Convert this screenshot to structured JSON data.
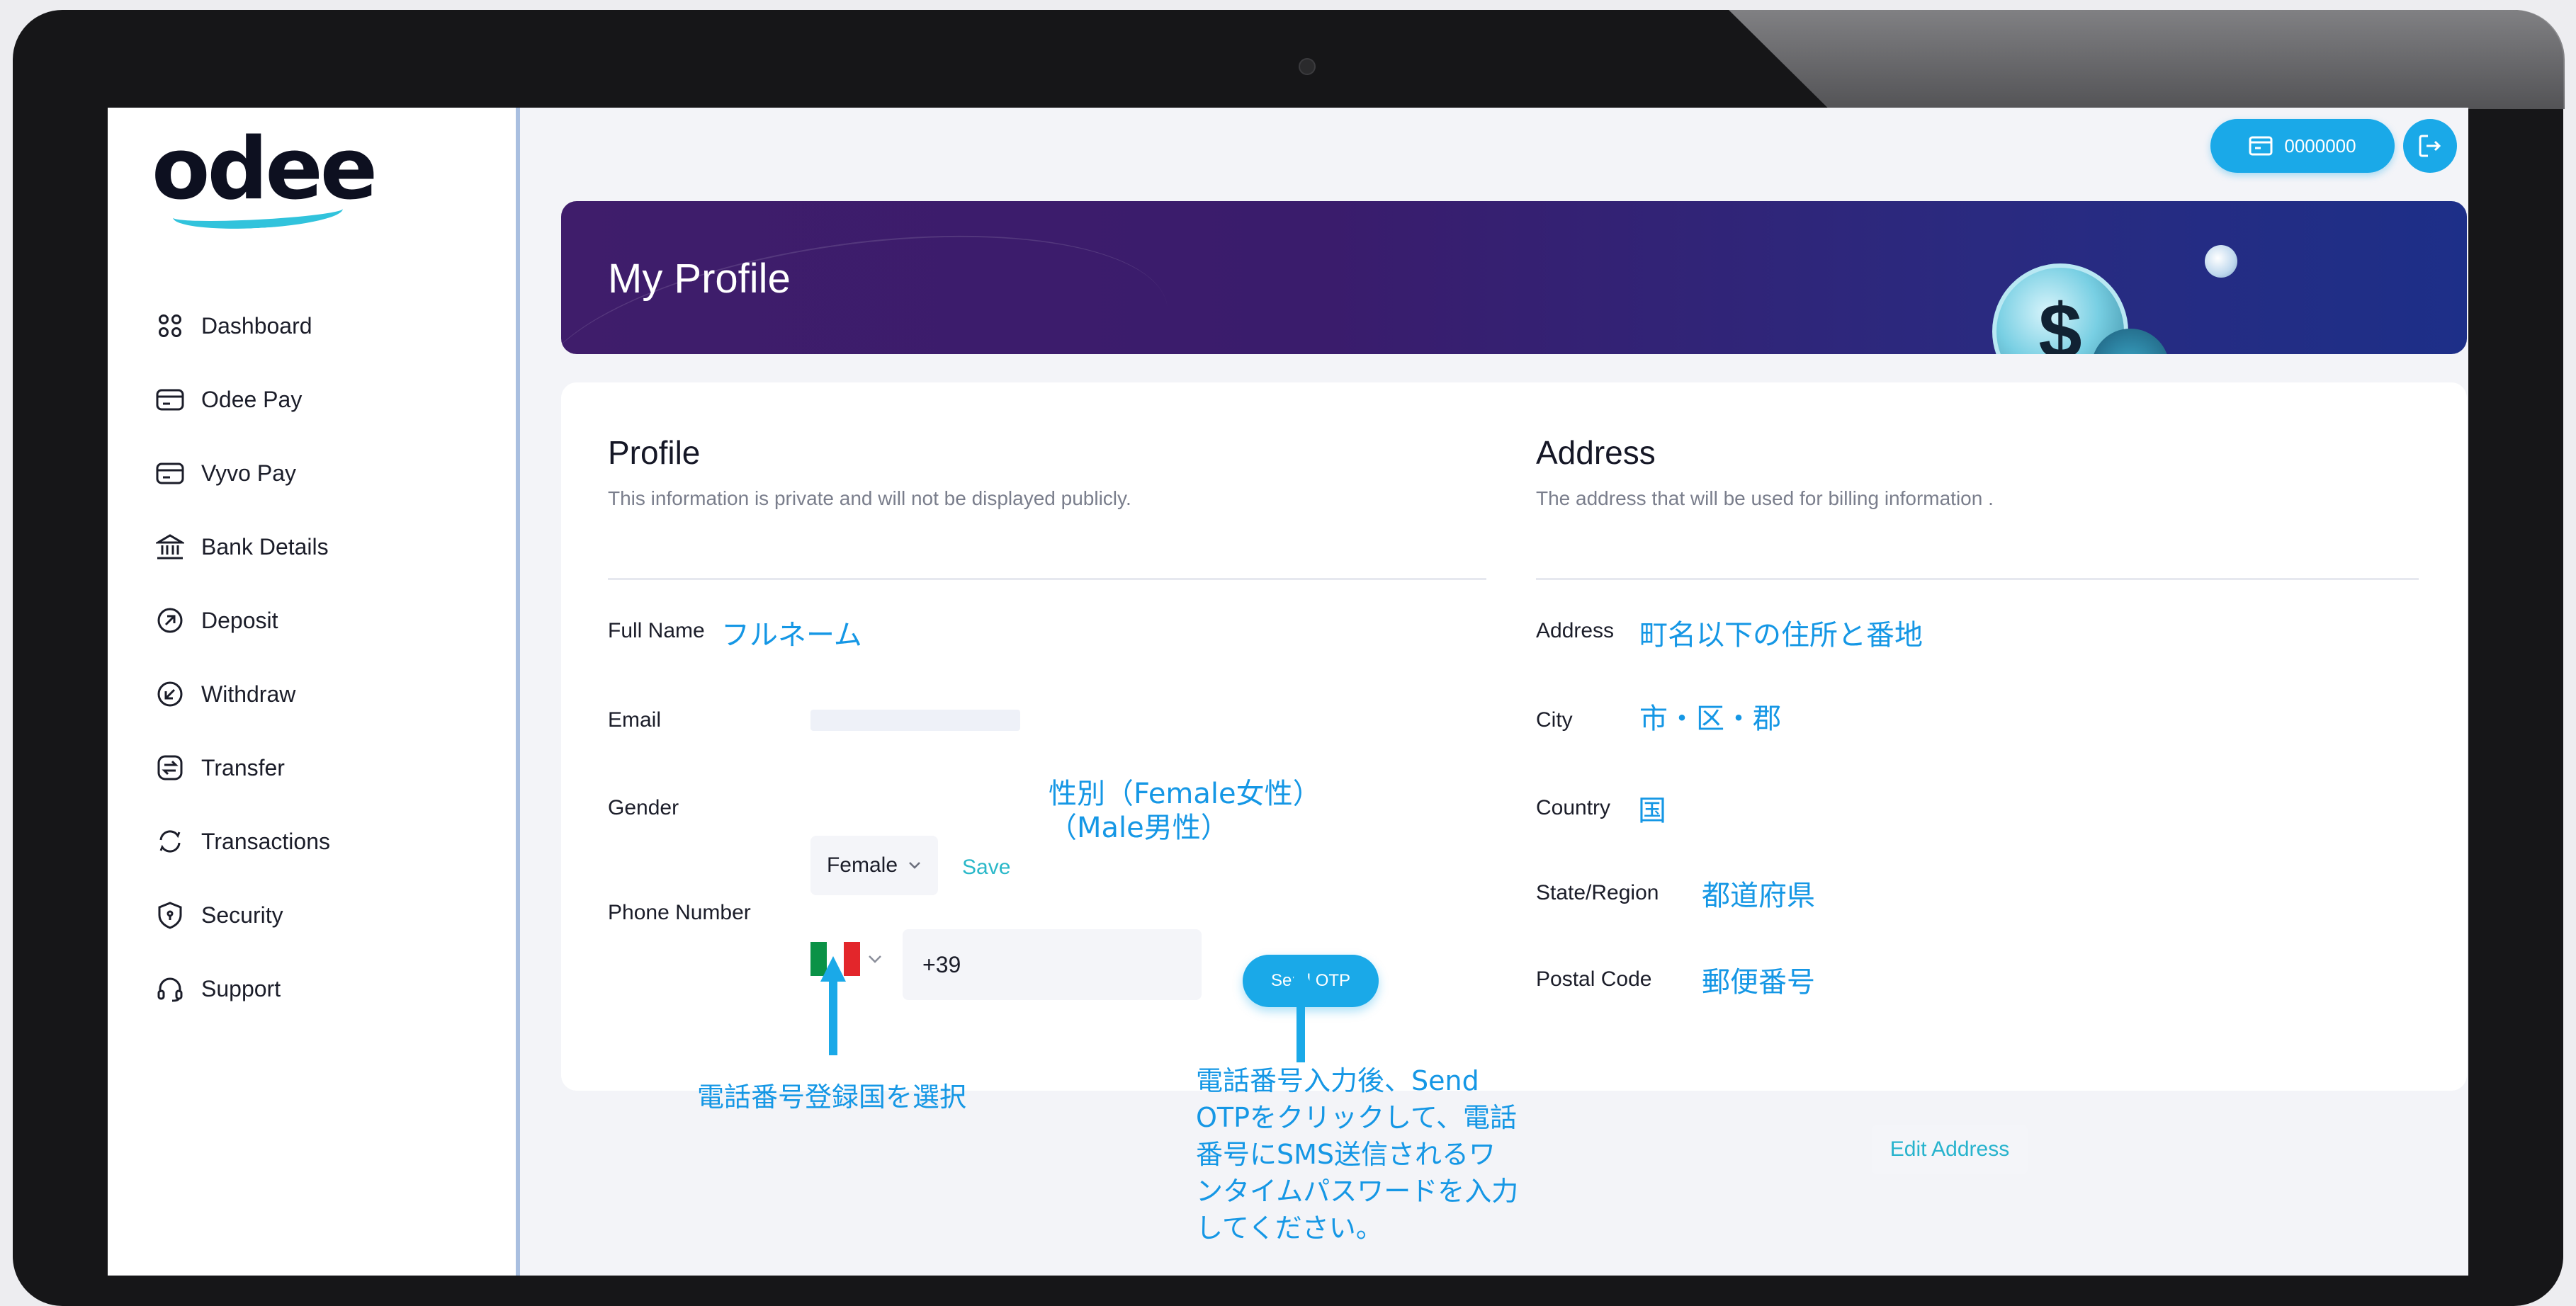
{
  "brand": {
    "logo": "odee"
  },
  "sidebar": {
    "items": [
      {
        "label": "Dashboard",
        "icon": "grid-icon"
      },
      {
        "label": "Odee Pay",
        "icon": "wallet-icon"
      },
      {
        "label": "Vyvo Pay",
        "icon": "wallet-icon"
      },
      {
        "label": "Bank Details",
        "icon": "bank-icon"
      },
      {
        "label": "Deposit",
        "icon": "arrow-up-circle-icon"
      },
      {
        "label": "Withdraw",
        "icon": "arrow-down-circle-icon"
      },
      {
        "label": "Transfer",
        "icon": "transfer-icon"
      },
      {
        "label": "Transactions",
        "icon": "refresh-icon"
      },
      {
        "label": "Security",
        "icon": "shield-icon"
      },
      {
        "label": "Support",
        "icon": "headset-icon"
      }
    ]
  },
  "header": {
    "wallet_value": "0000000"
  },
  "banner": {
    "title": "My Profile"
  },
  "profile": {
    "title": "Profile",
    "subtitle": "This information is private and will not be displayed publicly.",
    "full_name_label": "Full Name",
    "full_name_note": "フルネーム",
    "email_label": "Email",
    "gender_label": "Gender",
    "gender_value": "Female",
    "save_label": "Save",
    "gender_note_1": "性別（Female女性）",
    "gender_note_2": "（Male男性）",
    "phone_label": "Phone Number",
    "phone_code": "+39",
    "send_otp_label": "Send OTP",
    "flag_note": "電話番号登録国を選択",
    "otp_note": [
      "電話番号入力後、Send",
      "OTPをクリックして、電話",
      "番号にSMS送信されるワ",
      "ンタイムパスワードを入力",
      "してください。"
    ]
  },
  "address": {
    "title": "Address",
    "subtitle": "The address that will be used for billing information .",
    "address_label": "Address",
    "address_note": "町名以下の住所と番地",
    "city_label": "City",
    "city_note": "市・区・郡",
    "country_label": "Country",
    "country_note": "国",
    "state_label": "State/Region",
    "state_note": "都道府県",
    "postal_label": "Postal Code",
    "postal_note": "郵便番号",
    "edit_label": "Edit Address"
  },
  "colors": {
    "accent": "#1aa9e8",
    "annotation": "#1597e5",
    "banner_start": "#3f1d6b",
    "banner_end": "#1d2f88"
  }
}
